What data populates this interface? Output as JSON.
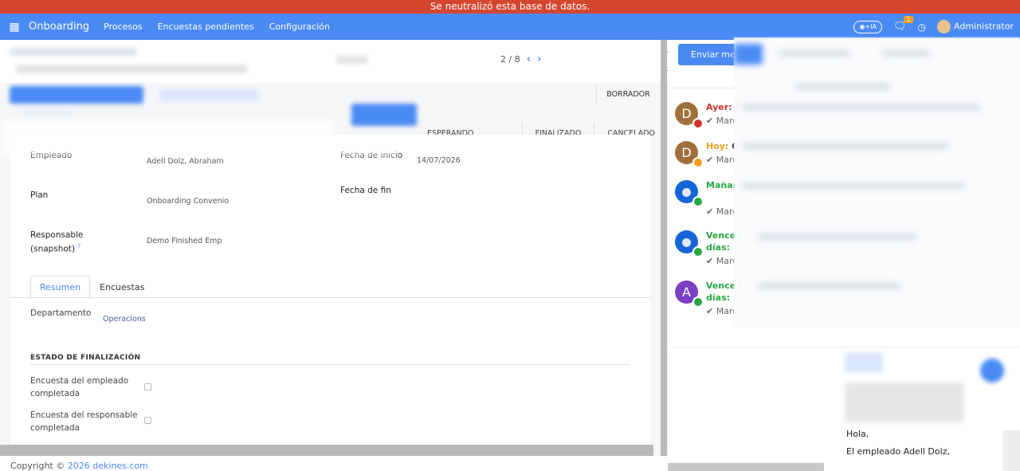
{
  "banner": "Se neutralizó esta base de datos.",
  "nav": {
    "brand": "Onboarding",
    "menus": [
      "Procesos",
      "Encuestas pendientes",
      "Configuración"
    ],
    "ia_label": "+IA",
    "chat_count": "1",
    "user": "Administrator"
  },
  "pager": {
    "text": "2 / 8"
  },
  "statuses": [
    "ESPERANDO ENCUESTAS",
    "FINALIZADO",
    "CANCELADO"
  ],
  "status_borrador": "BORRADOR",
  "form": {
    "empleado_label": "Empleado",
    "empleado_value": "Adell Dolz, Abraham",
    "fecha_inicio_label": "Fecha de inicio",
    "fecha_inicio_value": "14/07/2026",
    "plan_label": "Plan",
    "plan_value": "Onboarding Convenio",
    "fecha_fin_label": "Fecha de fin",
    "responsable_label_1": "Responsable",
    "responsable_label_2": "(snapshot)",
    "responsable_help": "?",
    "responsable_value": "Demo Finished Emp",
    "tabs": [
      "Resumen",
      "Encuestas"
    ],
    "departamento_label": "Departamento",
    "departamento_value": "Operacions",
    "section_title": "ESTADO DE FINALIZACIÓN",
    "encuesta_empleado_1": "Encuesta del empleado",
    "encuesta_empleado_2": "completada",
    "encuesta_responsable_1": "Encuesta del responsable",
    "encuesta_responsable_2": "completada"
  },
  "footer": {
    "prefix": "Copyright ©",
    "link": "2026 dekines.com"
  },
  "chatter": {
    "send_label": "Enviar mensaje",
    "activities": [
      {
        "initial": "D",
        "head": "Ayer:",
        "head_extra": "C",
        "sub": "Marc",
        "color": "#a0703a",
        "head_color": "#d0342c",
        "badge": "#d0342c"
      },
      {
        "initial": "D",
        "head": "Hoy:",
        "head_extra": "O",
        "sub": "Marc",
        "color": "#a0703a",
        "head_color": "#f0a020",
        "badge": "#f0a020"
      },
      {
        "initial": "",
        "head": "Mañana",
        "head_extra": "",
        "sub": "Marc",
        "color": "#1565d8",
        "head_color": "#28a745",
        "badge": "#28a745"
      },
      {
        "initial": "",
        "head": "Vence e",
        "head2": "días:",
        "head_extra": "",
        "sub": "Marc",
        "color": "#1565d8",
        "head_color": "#28a745",
        "badge": "#28a745"
      },
      {
        "initial": "A",
        "head": "Vence e",
        "head2": "días:",
        "head_extra": "",
        "sub": "Marc",
        "color": "#7b3fc4",
        "head_color": "#28a745",
        "badge": "#28a745"
      }
    ],
    "mail_greeting": "Hola,",
    "mail_line": "El  empleado  Adell  Dolz,"
  }
}
